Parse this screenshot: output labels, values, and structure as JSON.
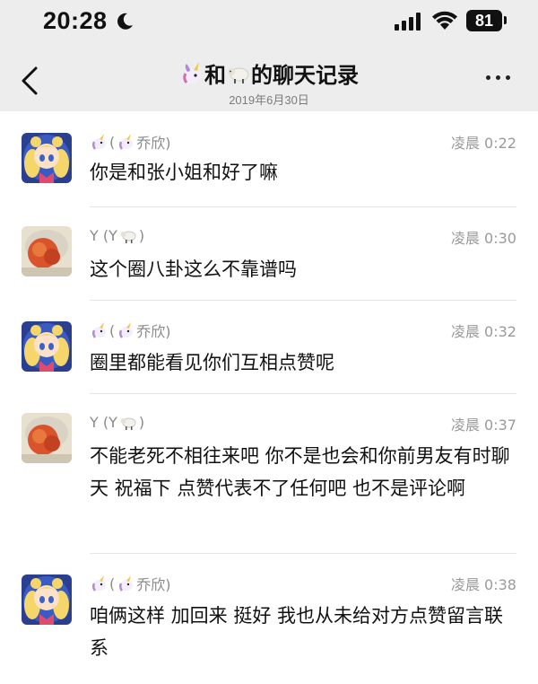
{
  "status_bar": {
    "time": "20:28",
    "battery": "81"
  },
  "header": {
    "title_part1": "和",
    "title_part2": "的聊天记录",
    "date": "2019年6月30日",
    "title_emoji_1": "unicorn-icon",
    "title_emoji_2": "sheep-icon"
  },
  "messages": [
    {
      "sender_prefix": "(",
      "sender_name": "乔欣)",
      "time": "凌晨 0:22",
      "text": "你是和张小姐和好了嘛",
      "avatar": "sailor-moon-avatar"
    },
    {
      "sender_prefix": "Y (Y",
      "sender_name": ")",
      "time": "凌晨 0:30",
      "text": "这个圈八卦这么不靠谱吗",
      "avatar": "orange-photo-avatar"
    },
    {
      "sender_prefix": "(",
      "sender_name": "乔欣)",
      "time": "凌晨 0:32",
      "text": "圈里都能看见你们互相点赞呢",
      "avatar": "sailor-moon-avatar"
    },
    {
      "sender_prefix": "Y (Y",
      "sender_name": ")",
      "time": "凌晨 0:37",
      "text": "不能老死不相往来吧 你不是也会和你前男友有时聊天 祝福下 点赞代表不了任何吧 也不是评论啊",
      "avatar": "orange-photo-avatar"
    },
    {
      "sender_prefix": "(",
      "sender_name": "乔欣)",
      "time": "凌晨 0:38",
      "text": "咱俩这样 加回来 挺好  我也从未给对方点赞留言联系",
      "avatar": "sailor-moon-avatar"
    }
  ]
}
